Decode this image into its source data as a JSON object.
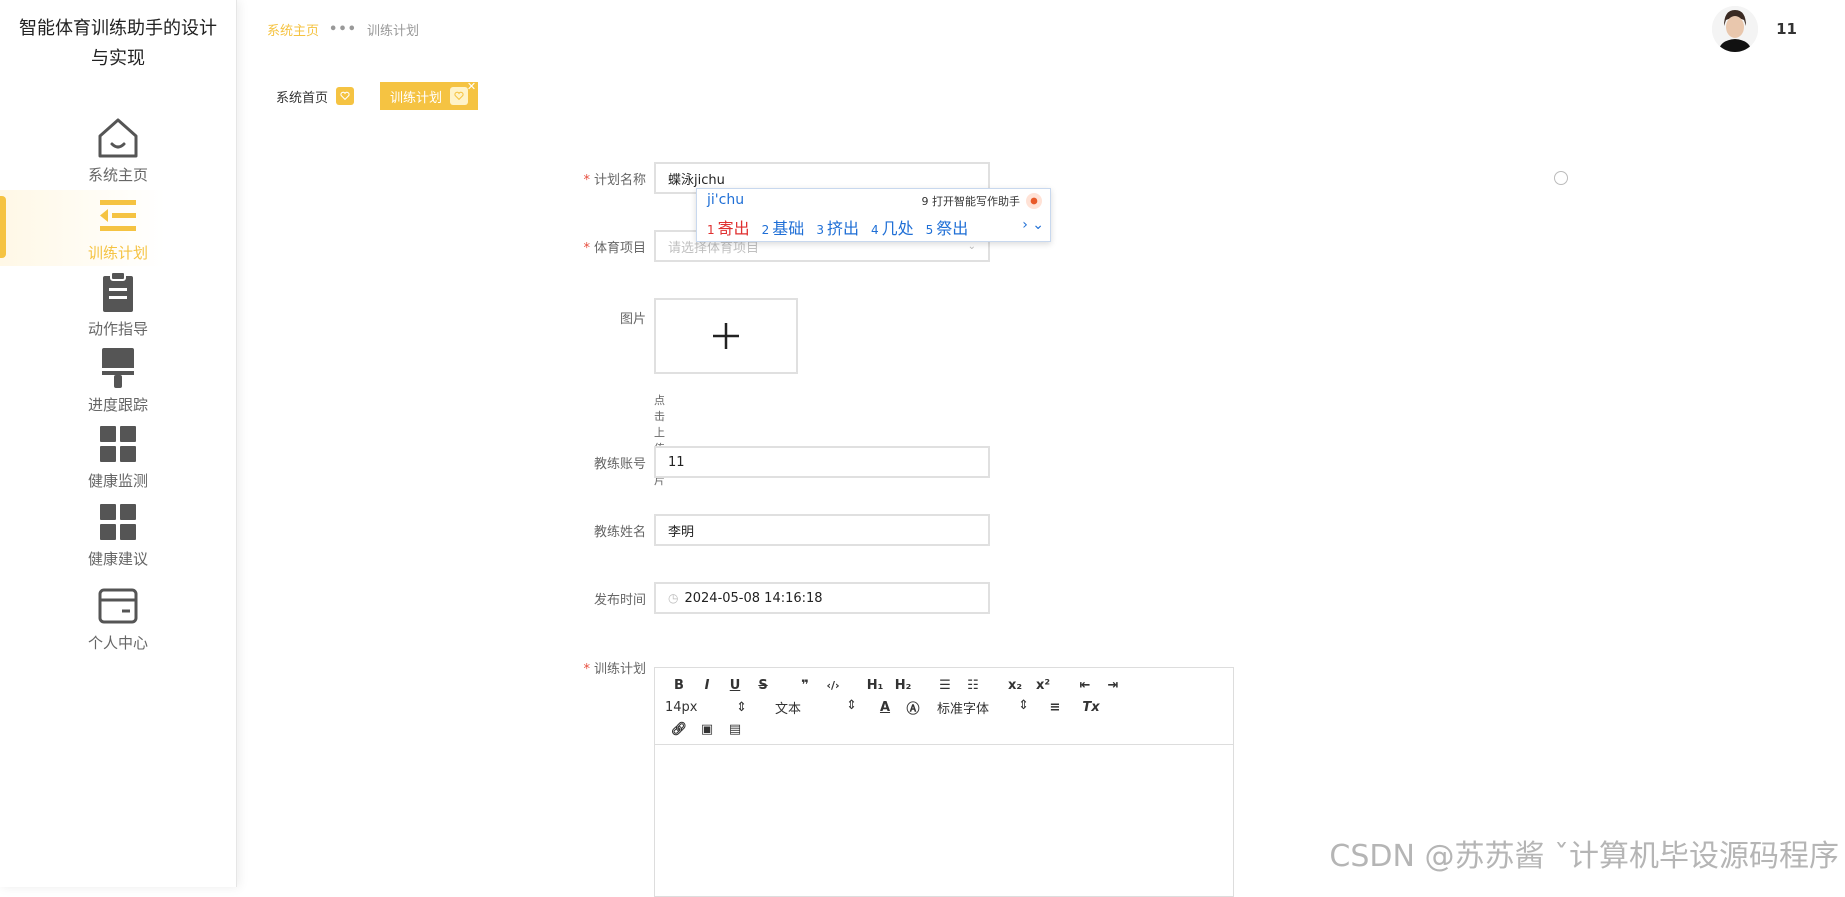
{
  "app": {
    "title": "智能体育训练助手的设计与实现"
  },
  "sidebar": {
    "items": [
      {
        "label": "系统主页",
        "icon": "home-icon"
      },
      {
        "label": "训练计划",
        "icon": "list-icon",
        "active": true
      },
      {
        "label": "动作指导",
        "icon": "clipboard-icon"
      },
      {
        "label": "进度跟踪",
        "icon": "brush-icon"
      },
      {
        "label": "健康监测",
        "icon": "grid-icon"
      },
      {
        "label": "健康建议",
        "icon": "grid-icon"
      },
      {
        "label": "个人中心",
        "icon": "card-icon"
      }
    ]
  },
  "breadcrumb": {
    "home": "系统主页",
    "current": "训练计划"
  },
  "user": {
    "name": "11"
  },
  "tags": [
    {
      "label": "系统首页"
    },
    {
      "label": "训练计划",
      "active": true
    }
  ],
  "form": {
    "plan_name": {
      "label": "计划名称",
      "value": "蝶泳jichu"
    },
    "sport": {
      "label": "体育项目",
      "placeholder": "请选择体育项目"
    },
    "image": {
      "label": "图片",
      "hint": "点击上传图片"
    },
    "coach_account": {
      "label": "教练账号",
      "value": "11"
    },
    "coach_name": {
      "label": "教练姓名",
      "value": "李明"
    },
    "publish_time": {
      "label": "发布时间",
      "value": "2024-05-08 14:16:18"
    },
    "training_plan": {
      "label": "训练计划"
    }
  },
  "ime": {
    "pinyin": "ji'chu",
    "assist_num": "9",
    "assist_text": "打开智能写作助手",
    "candidates": [
      {
        "num": "1",
        "text": "寄出"
      },
      {
        "num": "2",
        "text": "基础"
      },
      {
        "num": "3",
        "text": "挤出"
      },
      {
        "num": "4",
        "text": "几处"
      },
      {
        "num": "5",
        "text": "祭出"
      }
    ]
  },
  "editor": {
    "font_size": "14px",
    "paragraph": "文本",
    "font_family": "标准字体"
  },
  "watermark": "CSDN @苏苏酱   ˇ计算机毕设源码程序",
  "colors": {
    "accent": "#f5c342",
    "required": "#e74c3c",
    "ime_blue": "#1f6fd6"
  }
}
